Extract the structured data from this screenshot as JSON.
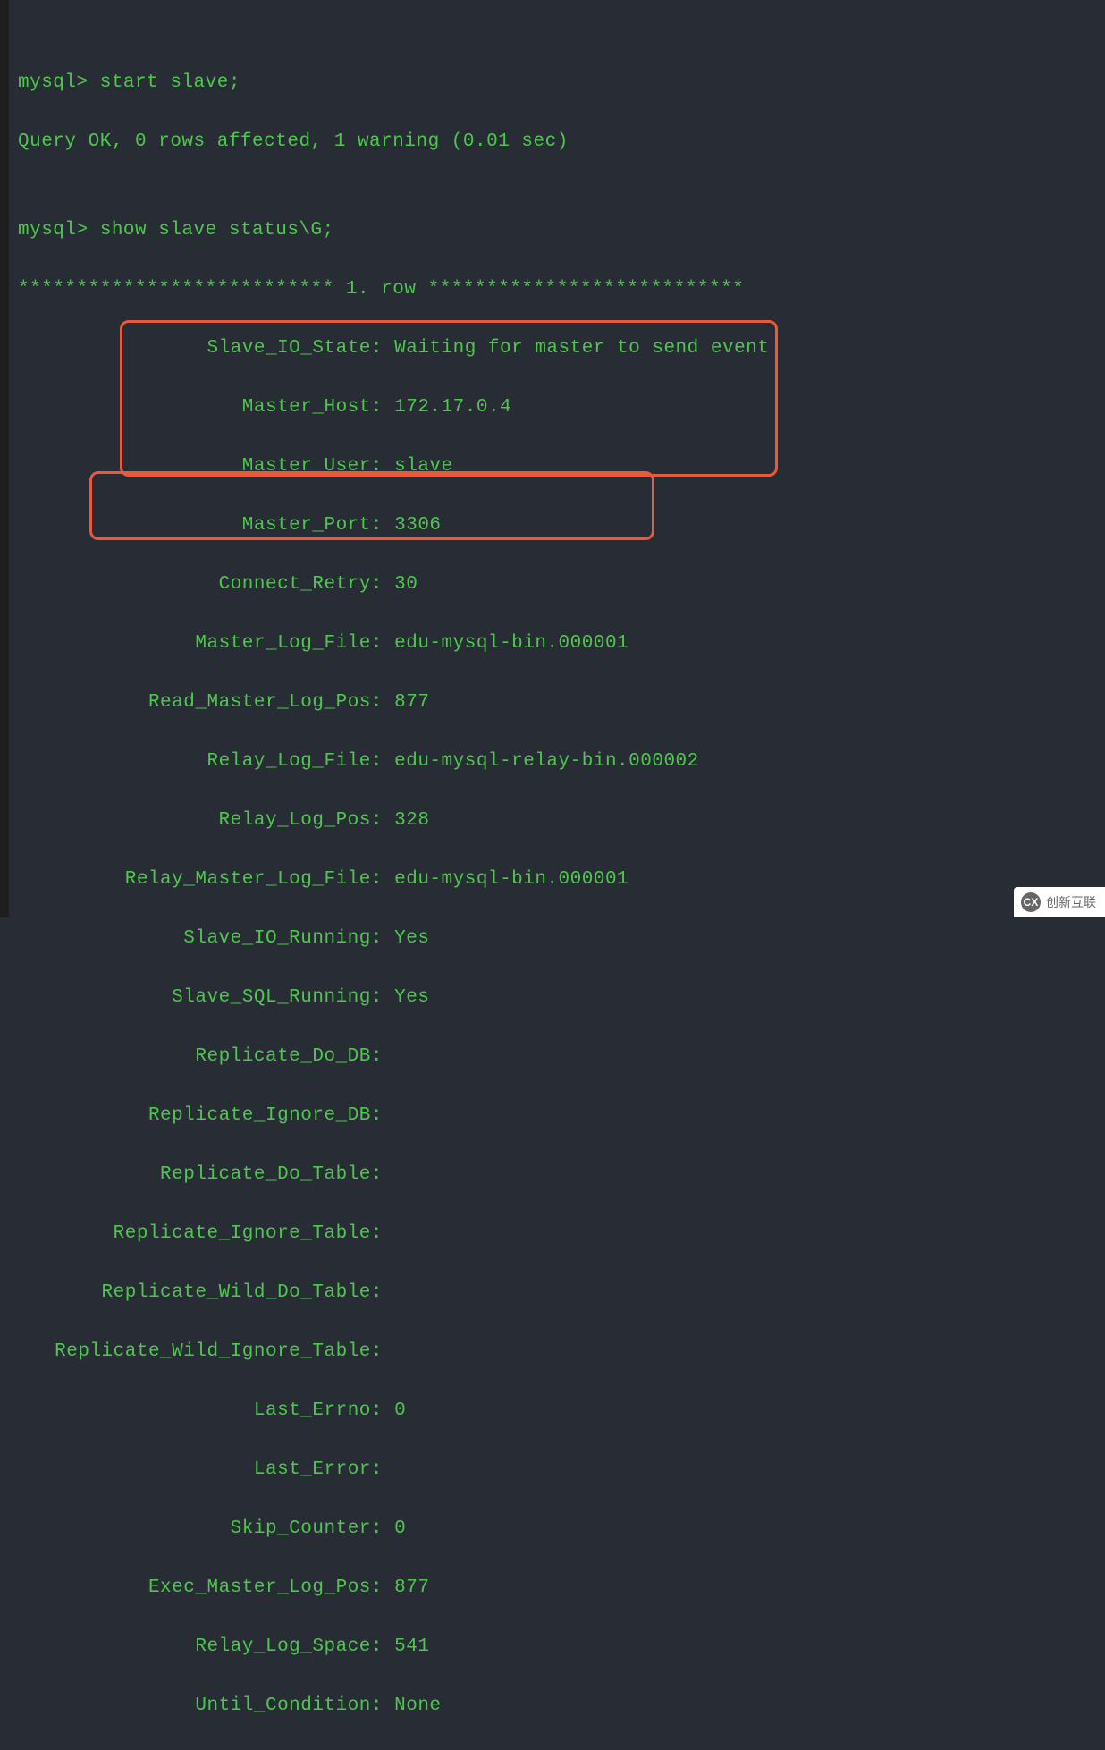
{
  "terminal": {
    "blank0": "",
    "cmd1": "mysql> start slave;",
    "result1": "Query OK, 0 rows affected, 1 warning (0.01 sec)",
    "blank1": "",
    "cmd2": "mysql> show slave status\\G;",
    "row_header": "*************************** 1. row ***************************",
    "fields": [
      {
        "label": "Slave_IO_State:",
        "value": "Waiting for master to send event"
      },
      {
        "label": "Master_Host:",
        "value": "172.17.0.4"
      },
      {
        "label": "Master_User:",
        "value": "slave"
      },
      {
        "label": "Master_Port:",
        "value": "3306"
      },
      {
        "label": "Connect_Retry:",
        "value": "30"
      },
      {
        "label": "Master_Log_File:",
        "value": "edu-mysql-bin.000001"
      },
      {
        "label": "Read_Master_Log_Pos:",
        "value": "877"
      },
      {
        "label": "Relay_Log_File:",
        "value": "edu-mysql-relay-bin.000002"
      },
      {
        "label": "Relay_Log_Pos:",
        "value": "328"
      },
      {
        "label": "Relay_Master_Log_File:",
        "value": "edu-mysql-bin.000001"
      },
      {
        "label": "Slave_IO_Running:",
        "value": "Yes"
      },
      {
        "label": "Slave_SQL_Running:",
        "value": "Yes"
      },
      {
        "label": "Replicate_Do_DB:",
        "value": ""
      },
      {
        "label": "Replicate_Ignore_DB:",
        "value": ""
      },
      {
        "label": "Replicate_Do_Table:",
        "value": ""
      },
      {
        "label": "Replicate_Ignore_Table:",
        "value": ""
      },
      {
        "label": "Replicate_Wild_Do_Table:",
        "value": ""
      },
      {
        "label": "Replicate_Wild_Ignore_Table:",
        "value": ""
      },
      {
        "label": "Last_Errno:",
        "value": "0"
      },
      {
        "label": "Last_Error:",
        "value": ""
      },
      {
        "label": "Skip_Counter:",
        "value": "0"
      },
      {
        "label": "Exec_Master_Log_Pos:",
        "value": "877"
      },
      {
        "label": "Relay_Log_Space:",
        "value": "541"
      },
      {
        "label": "Until_Condition:",
        "value": "None"
      }
    ]
  },
  "watermark": {
    "logo": "CX",
    "text": "创新互联"
  }
}
